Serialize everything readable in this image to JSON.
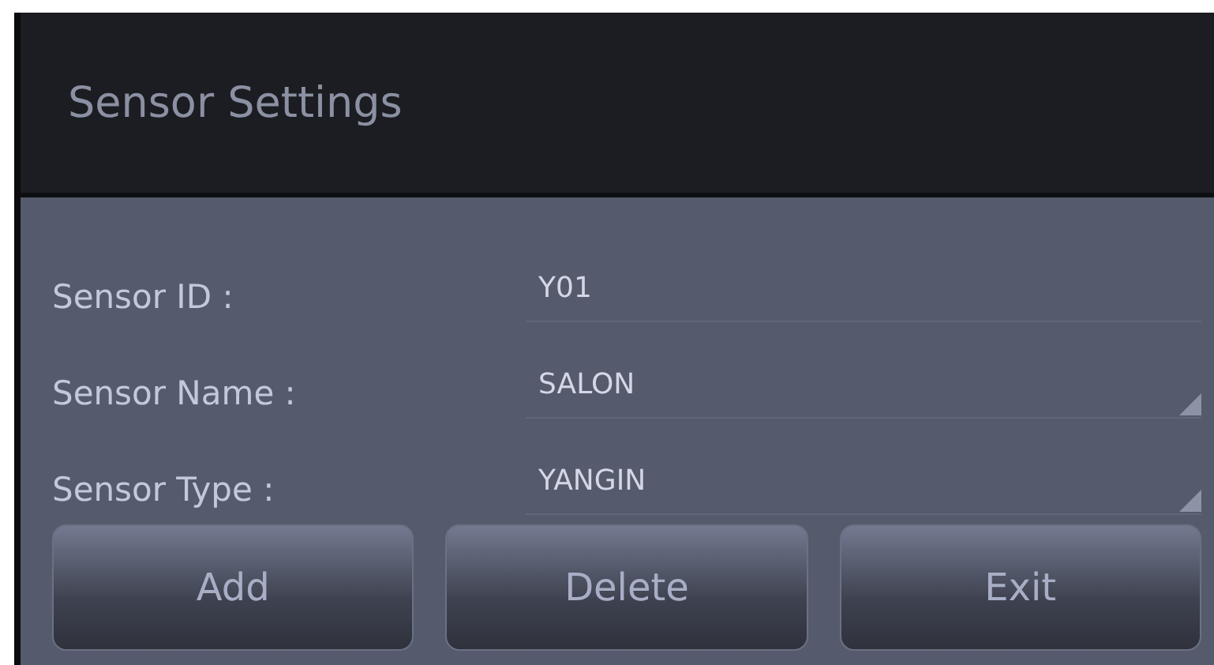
{
  "dialog": {
    "title": "Sensor Settings"
  },
  "fields": [
    {
      "label": "Sensor ID :",
      "value": "Y01",
      "kind": "text"
    },
    {
      "label": "Sensor Name :",
      "value": "SALON",
      "kind": "spinner"
    },
    {
      "label": "Sensor Type :",
      "value": "YANGIN",
      "kind": "spinner"
    }
  ],
  "buttons": [
    "Add",
    "Delete",
    "Exit"
  ]
}
